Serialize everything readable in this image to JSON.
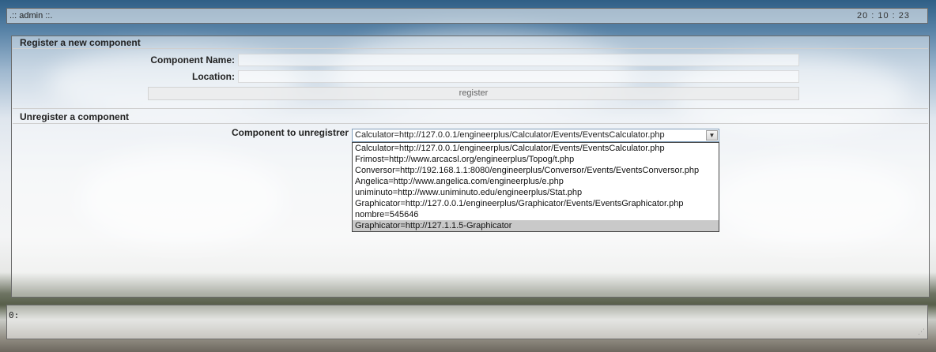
{
  "topbar": {
    "title": ".:: admin ::.",
    "clock": "20 : 10 : 23"
  },
  "register": {
    "heading": "Register a new component",
    "name_label": "Component Name:",
    "name_value": "",
    "location_label": "Location:",
    "location_value": "",
    "button_label": "register"
  },
  "unregister": {
    "heading": "Unregister a component",
    "select_label": "Component to unregistrer",
    "selected": "Calculator=http://127.0.0.1/engineerplus/Calculator/Events/EventsCalculator.php",
    "options": [
      "Calculator=http://127.0.0.1/engineerplus/Calculator/Events/EventsCalculator.php",
      "Frimost=http://www.arcacsl.org/engineerplus/Topog/t.php",
      "Conversor=http://192.168.1.1:8080/engineerplus/Conversor/Events/EventsConversor.php",
      "Angelica=http://www.angelica.com/engineerplus/e.php",
      "uniminuto=http://www.uniminuto.edu/engineerplus/Stat.php",
      "Graphicator=http://127.0.0.1/engineerplus/Graphicator/Events/EventsGraphicator.php",
      "nombre=545646",
      "Graphicator=http://127.1.1.5-Graphicator"
    ],
    "highlighted_index": 7
  },
  "status": {
    "text": "0:"
  },
  "icons": {
    "dropdown_arrow": "chevron-down-icon",
    "resize": "resize-grip-icon"
  }
}
